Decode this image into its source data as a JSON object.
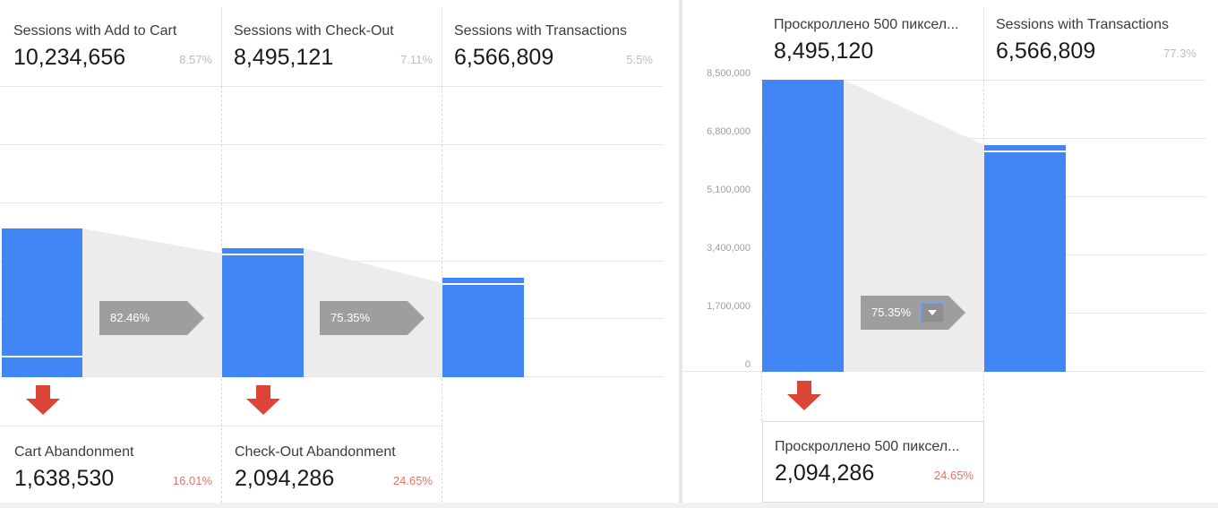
{
  "left_funnel": {
    "steps": [
      {
        "title": "Sessions with Add to Cart",
        "value": "10,234,656",
        "pct": "8.57%"
      },
      {
        "title": "Sessions with Check-Out",
        "value": "8,495,121",
        "pct": "7.11%"
      },
      {
        "title": "Sessions with Transactions",
        "value": "6,566,809",
        "pct": "5.5%"
      }
    ],
    "conversions": [
      "82.46%",
      "75.35%"
    ],
    "abandonments": [
      {
        "title": "Cart Abandonment",
        "value": "1,638,530",
        "pct": "16.01%"
      },
      {
        "title": "Check-Out Abandonment",
        "value": "2,094,286",
        "pct": "24.65%"
      }
    ]
  },
  "right_funnel": {
    "steps": [
      {
        "title": "Проскроллено 500 пиксел...",
        "value": "8,495,120",
        "pct": ""
      },
      {
        "title": "Sessions with Transactions",
        "value": "6,566,809",
        "pct": "77.3%"
      }
    ],
    "conversion": "75.35%",
    "abandonment": {
      "title": "Проскроллено 500 пиксел...",
      "value": "2,094,286",
      "pct": "24.65%"
    },
    "y_axis_ticks": [
      "8,500,000",
      "6,800,000",
      "5,100,000",
      "3,400,000",
      "1,700,000",
      "0"
    ]
  },
  "colors": {
    "bar": "#4285f4",
    "funnel_fill": "#ececec",
    "conversion_arrow": "#9e9e9e",
    "abandon_arrow": "#db4437",
    "abandon_pct": "#e57368"
  },
  "icons": {
    "abandon": "down-arrow-icon",
    "conversion": "right-arrow-shape",
    "dropdown": "caret-down-icon"
  }
}
